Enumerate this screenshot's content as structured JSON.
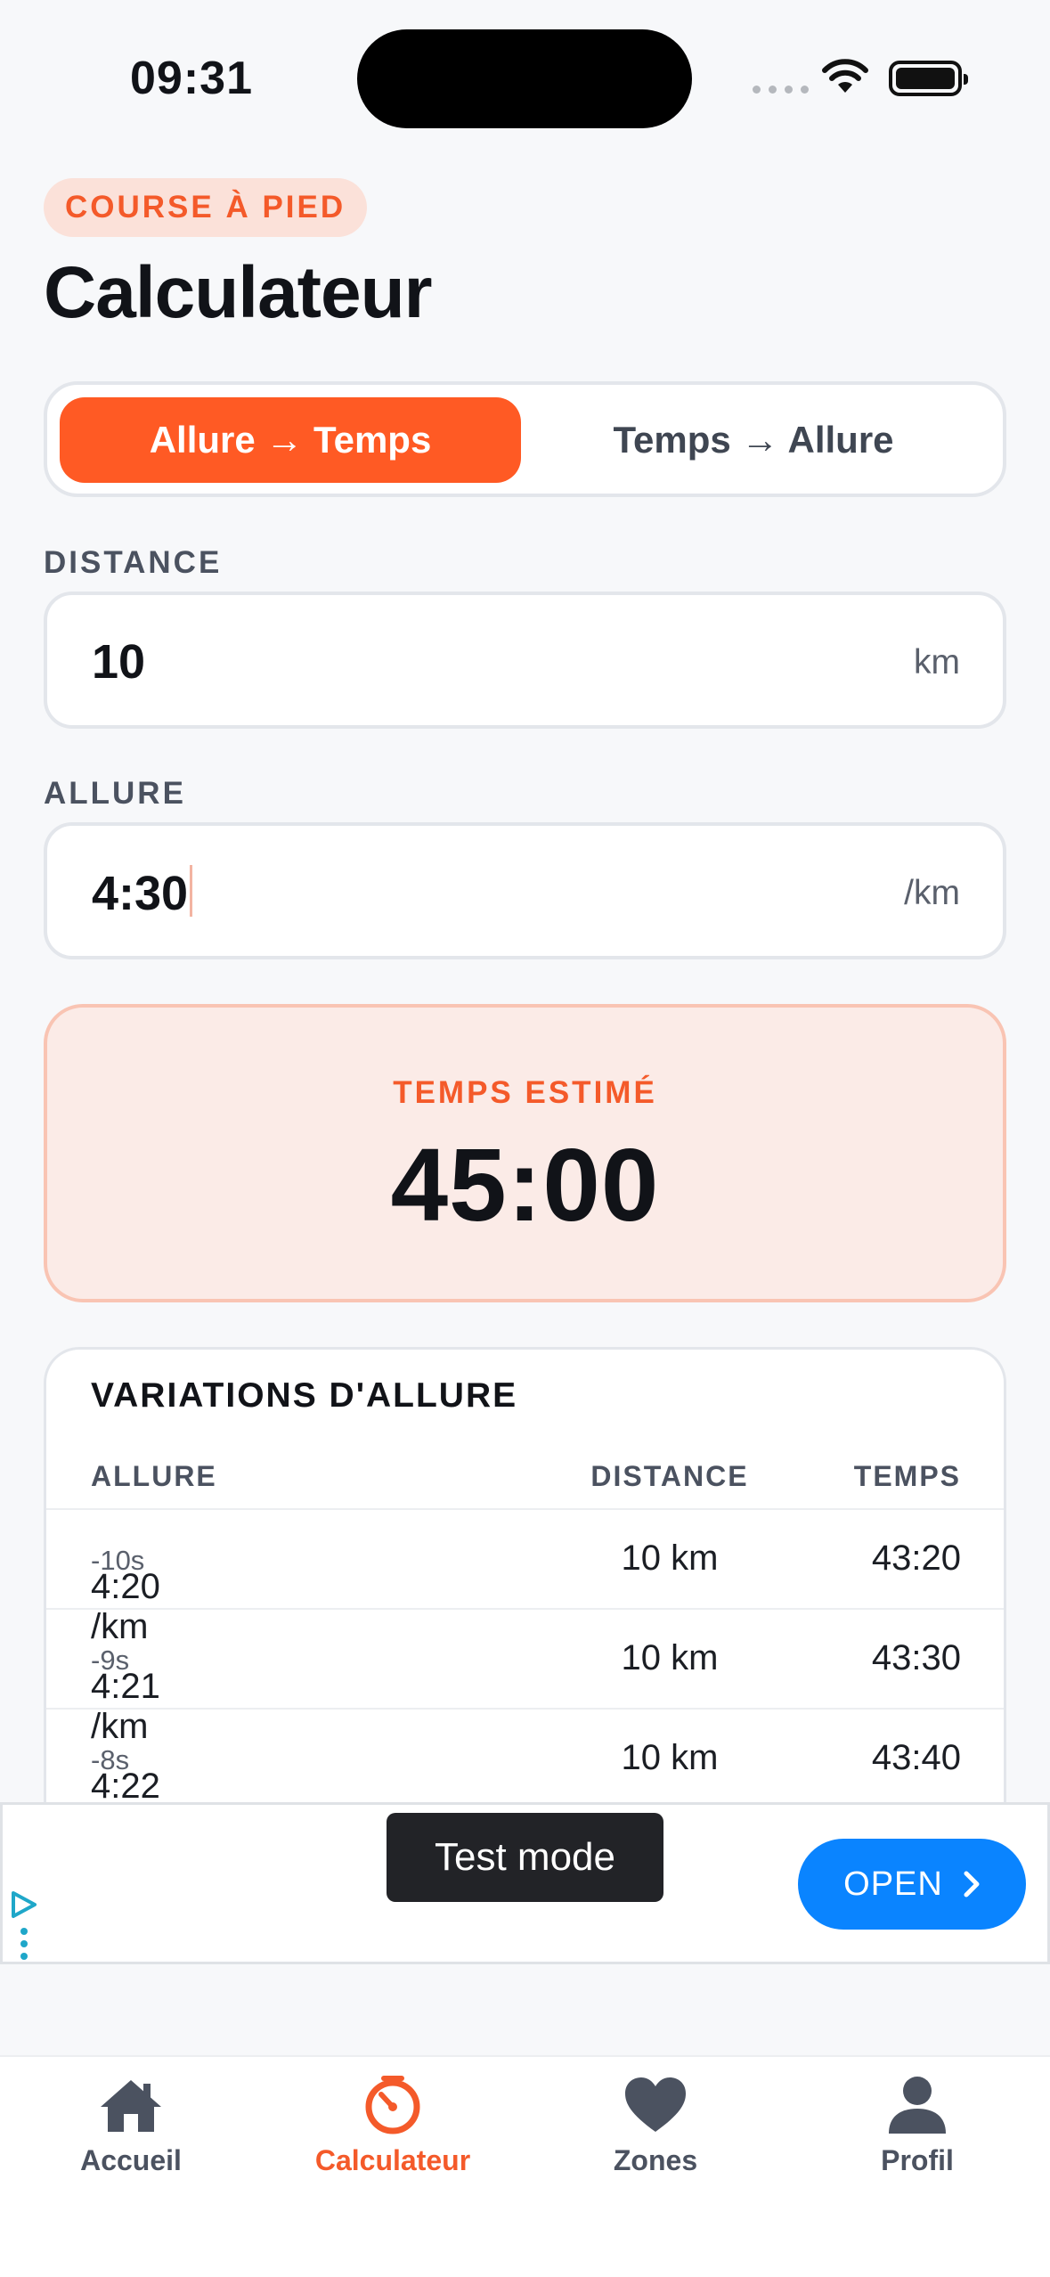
{
  "status_bar": {
    "time": "09:31"
  },
  "header": {
    "badge": "COURSE À PIED",
    "title": "Calculateur"
  },
  "mode_toggle": {
    "options": [
      {
        "label": "Allure → Temps",
        "selected": true
      },
      {
        "label": "Temps → Allure",
        "selected": false
      }
    ]
  },
  "distance": {
    "label": "DISTANCE",
    "value": "10",
    "unit": "km"
  },
  "pace": {
    "label": "ALLURE",
    "value": "4:30",
    "unit": "/km"
  },
  "result": {
    "label": "TEMPS ESTIMÉ",
    "value": "45:00"
  },
  "variations": {
    "title": "VARIATIONS D'ALLURE",
    "columns": [
      "ALLURE",
      "DISTANCE",
      "TEMPS"
    ],
    "rows": [
      {
        "pace": "4:20 /km",
        "delta": "-10s",
        "distance": "10 km",
        "time": "43:20"
      },
      {
        "pace": "4:21 /km",
        "delta": "-9s",
        "distance": "10 km",
        "time": "43:30"
      },
      {
        "pace": "4:22 /km",
        "delta": "-8s",
        "distance": "10 km",
        "time": "43:40"
      }
    ]
  },
  "ad": {
    "toast": "Test mode",
    "cta": "OPEN"
  },
  "tabbar": {
    "items": [
      {
        "label": "Accueil",
        "icon": "home-icon",
        "active": false
      },
      {
        "label": "Calculateur",
        "icon": "stopwatch-icon",
        "active": true
      },
      {
        "label": "Zones",
        "icon": "heart-icon",
        "active": false
      },
      {
        "label": "Profil",
        "icon": "person-icon",
        "active": false
      }
    ]
  },
  "colors": {
    "accent": "#ff5a24",
    "badge_bg": "#fbe1d9",
    "result_bg": "#fbebe7",
    "ad_button": "#0a84ff",
    "text": "#111318"
  }
}
